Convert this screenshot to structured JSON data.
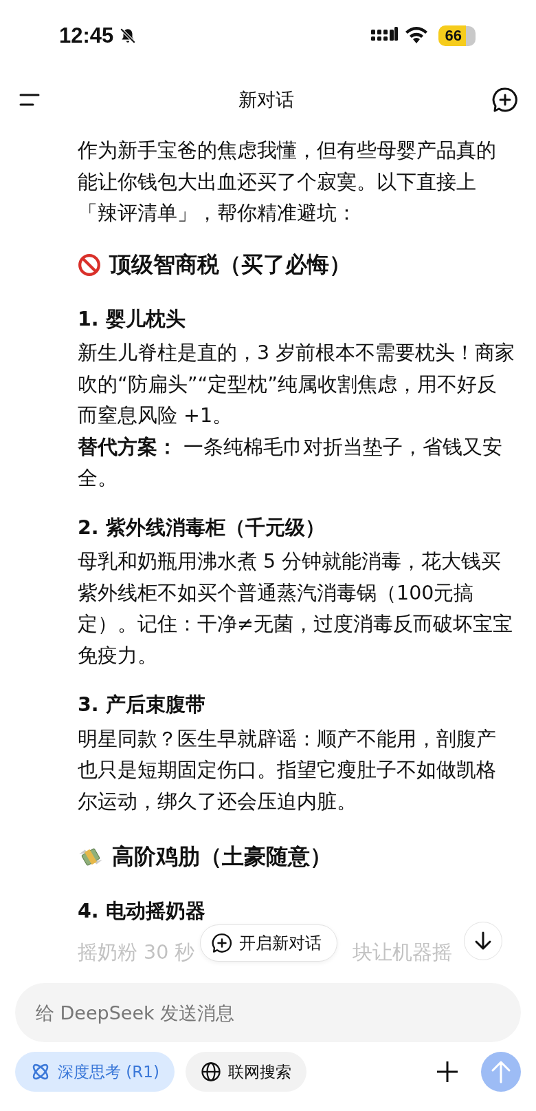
{
  "status_bar": {
    "time": "12:45",
    "battery": "66"
  },
  "header": {
    "title": "新对话"
  },
  "blocks": [
    {
      "kind": "paragraph",
      "text": "作为新手宝爸的焦虑我懂，但有些母婴产品真的能让你钱包大出血还买了个寂寞。以下直接上「辣评清单」，帮你精准避坑："
    },
    {
      "kind": "heading",
      "text": "顶级智商税（买了必悔）"
    },
    {
      "kind": "item",
      "title": "1. 婴儿枕头",
      "paragraphs": [
        "新生儿脊柱是直的，3 岁前根本不需要枕头！商家吹的“防扁头”“定型枕”纯属收割焦虑，用不好反而窒息风险 +1。",
        "**替代方案：** 一条纯棉毛巾对折当垫子，省钱又安全。"
      ]
    },
    {
      "kind": "item",
      "title": "2. 紫外线消毒柜（千元级）",
      "paragraphs": [
        "母乳和奶瓶用沸水煮 5 分钟就能消毒，花大钱买紫外线柜不如买个普通蒸汽消毒锅（100元搞定）。记住：干净≠无菌，过度消毒反而破坏宝宝免疫力。"
      ]
    },
    {
      "kind": "item",
      "title": "3. 产后束腹带",
      "paragraphs": [
        "明星同款？医生早就辟谣：顺产不能用，剖腹产也只是短期固定伤口。指望它瘦肚子不如做凯格尔运动，绑久了还会压迫内脏。"
      ]
    },
    {
      "kind": "heading",
      "text": "高阶鸡肋（土豪随意）"
    },
    {
      "kind": "item",
      "title": "4. 电动摇奶器"
    }
  ],
  "partial_line": [
    "摇奶粉 30 秒",
    "块让机器摇"
  ],
  "new_chat_button": "开启新对话",
  "composer": {
    "placeholder": "给 DeepSeek 发送消息",
    "chips": [
      {
        "label": "深度思考 (R1)",
        "selected": true
      },
      {
        "label": "联网搜索",
        "selected": false
      }
    ],
    "send_disabled": true
  }
}
